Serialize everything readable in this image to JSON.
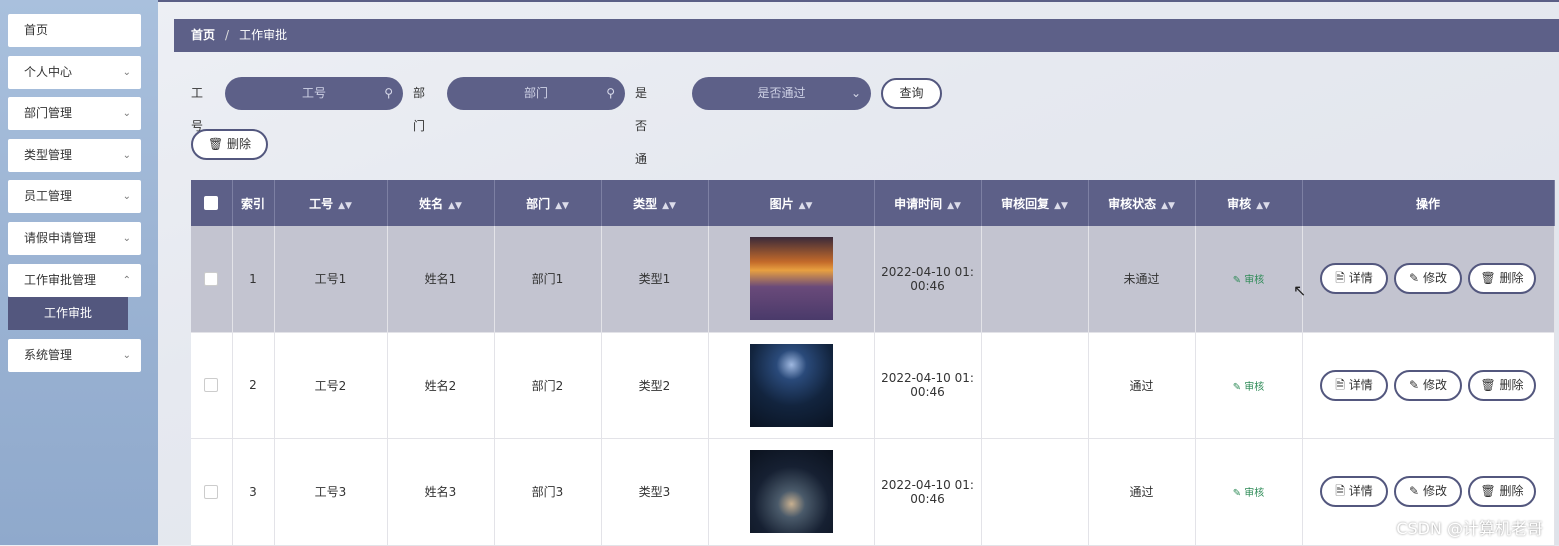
{
  "sidebar": {
    "items": [
      {
        "label": "首页",
        "has_chevron": false
      },
      {
        "label": "个人中心",
        "has_chevron": true
      },
      {
        "label": "部门管理",
        "has_chevron": true
      },
      {
        "label": "类型管理",
        "has_chevron": true
      },
      {
        "label": "员工管理",
        "has_chevron": true
      },
      {
        "label": "请假申请管理",
        "has_chevron": true
      },
      {
        "label": "工作审批管理",
        "has_chevron": true
      },
      {
        "label": "系统管理",
        "has_chevron": true
      }
    ],
    "sub_active": "工作审批",
    "chevron_icon": "chevron-down-icon"
  },
  "breadcrumb": {
    "home": "首页",
    "separator": "/",
    "current": "工作审批"
  },
  "search": {
    "gonghao_label": "工号",
    "gonghao_placeholder": "工号",
    "bumen_label": "部门",
    "bumen_placeholder": "部门",
    "tongguo_label": "是否通过",
    "tongguo_placeholder": "是否通过",
    "query_button": "查询"
  },
  "actions": {
    "delete_button": "删除"
  },
  "table": {
    "columns": [
      "索引",
      "工号",
      "姓名",
      "部门",
      "类型",
      "图片",
      "申请时间",
      "审核回复",
      "审核状态",
      "审核",
      "操作"
    ],
    "rows": [
      {
        "index": "1",
        "gonghao": "工号1",
        "name": "姓名1",
        "dept": "部门1",
        "type": "类型1",
        "time_line1": "2022-04-10 01:",
        "time_line2": "00:46",
        "reply": "",
        "status": "未通过",
        "audit": "审核"
      },
      {
        "index": "2",
        "gonghao": "工号2",
        "name": "姓名2",
        "dept": "部门2",
        "type": "类型2",
        "time_line1": "2022-04-10 01:",
        "time_line2": "00:46",
        "reply": "",
        "status": "通过",
        "audit": "审核"
      },
      {
        "index": "3",
        "gonghao": "工号3",
        "name": "姓名3",
        "dept": "部门3",
        "type": "类型3",
        "time_line1": "2022-04-10 01:",
        "time_line2": "00:46",
        "reply": "",
        "status": "通过",
        "audit": "审核"
      }
    ],
    "row_buttons": {
      "detail": "详情",
      "edit": "修改",
      "delete": "删除"
    }
  },
  "watermark": "CSDN @计算机老哥",
  "colors": {
    "accent": "#5d6088",
    "audit": "#2e8b57",
    "selected_row": "#c3c4d0"
  }
}
